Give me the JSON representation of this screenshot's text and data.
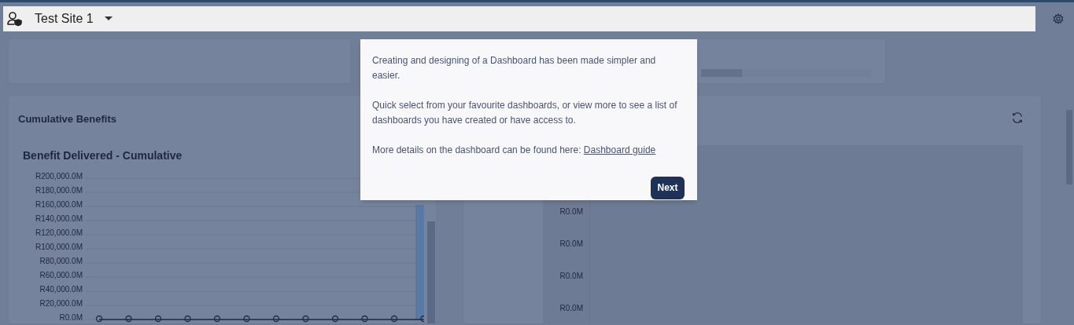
{
  "top_bar": {
    "site": "Test Site 1"
  },
  "cumulative_benefits": {
    "title": "Cumulative Benefits",
    "y_axis_labels": [
      "R200,000.0M",
      "R180,000.0M",
      "R160,000.0M",
      "R140,000.0M",
      "R120,000.0M",
      "R100,000.0M",
      "R80,000.0M",
      "R60,000.0M",
      "R40,000.0M",
      "R20,000.0M",
      "R0.0M"
    ],
    "chart_title": "Benefit Delivered - Cumulative"
  },
  "second_chart": {
    "axis_labels": [
      "R0.0M",
      "R0.0M",
      "R0.0M",
      "R0.0M"
    ]
  },
  "tour_popup": {
    "paragraphs": [
      "Creating and designing of a Dashboard has been made simpler and easier.",
      "Quick select from your favourite dashboards, or view more to see a list of dashboards you have created or have access to.",
      "More details on the dashboard can be found here:"
    ],
    "link": "Dashboard guide",
    "button": "Next"
  }
}
